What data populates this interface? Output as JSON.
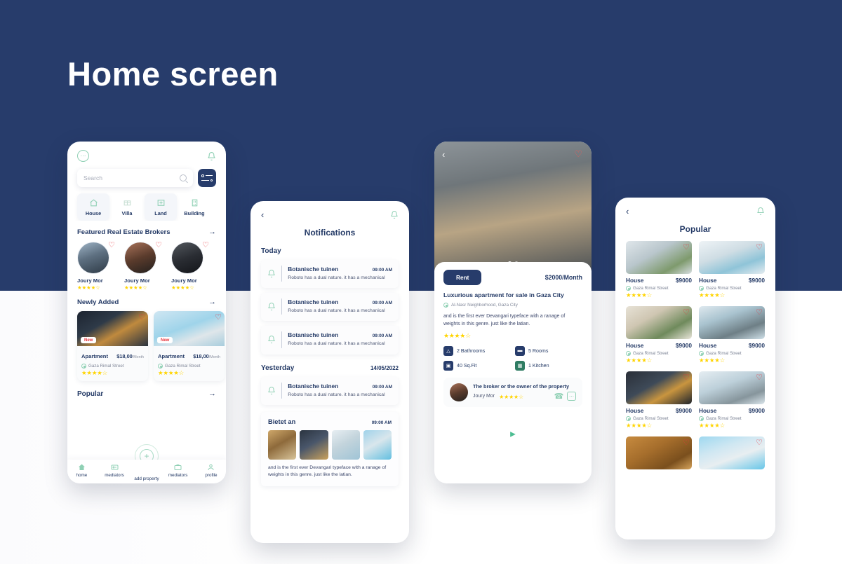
{
  "page": {
    "title": "Home screen",
    "bg_navy": "#273c6b",
    "accent_mint": "#8fd0b4",
    "accent_star": "#ffd400",
    "accent_heart": "#e8343c"
  },
  "screen1": {
    "icons": {
      "chat": "chat-icon",
      "bell": "bell-icon"
    },
    "search": {
      "placeholder": "Search",
      "value": ""
    },
    "filter_label": "filter-button",
    "categories": [
      {
        "label": "House",
        "icon": "house-icon",
        "active": true
      },
      {
        "label": "Villa",
        "icon": "villa-icon",
        "active": false
      },
      {
        "label": "Land",
        "icon": "land-icon",
        "active": true
      },
      {
        "label": "Building",
        "icon": "building-icon",
        "active": false
      }
    ],
    "brokers_section": {
      "title": "Featured Real Estate Brokers",
      "arrow": "→"
    },
    "brokers": [
      {
        "name": "Joury Mor",
        "stars": "★★★★☆"
      },
      {
        "name": "Joury Mor",
        "stars": "★★★★☆"
      },
      {
        "name": "Joury Mor",
        "stars": "★★★★☆"
      }
    ],
    "newly_section": {
      "title": "Newly Added",
      "arrow": "→"
    },
    "newly": [
      {
        "badge": "New",
        "type": "Apartment",
        "price": "$18,00",
        "per": "/Month",
        "location": "Gaza Rimal Street",
        "stars": "★★★★☆"
      },
      {
        "badge": "New",
        "type": "Apartment",
        "price": "$18,00",
        "per": "/Month",
        "location": "Gaza Rimal Street",
        "stars": "★★★★☆"
      }
    ],
    "popular_section": {
      "title": "Popular",
      "arrow": "→"
    },
    "nav": [
      {
        "label": "home",
        "icon": "home-icon"
      },
      {
        "label": "mediators",
        "icon": "mediators-icon"
      },
      {
        "label": "add property",
        "icon": "plus-icon"
      },
      {
        "label": "mediators",
        "icon": "briefcase-icon"
      },
      {
        "label": "profile",
        "icon": "profile-icon"
      }
    ]
  },
  "screen2": {
    "back": "‹",
    "bell": "bell-icon",
    "title": "Notifications",
    "today_label": "Today",
    "yesterday_label": "Yesterday",
    "yesterday_date": "14/05/2022",
    "items_today": [
      {
        "title": "Botanische tuinen",
        "time": "09:00 AM",
        "body": "Roboto has a dual nature.  it has a mechanical"
      },
      {
        "title": "Botanische tuinen",
        "time": "09:00 AM",
        "body": "Roboto has a dual nature.  it has a mechanical"
      },
      {
        "title": "Botanische tuinen",
        "time": "09:00 AM",
        "body": "Roboto has a dual nature.  it has a mechanical"
      }
    ],
    "items_yesterday": [
      {
        "title": "Botanische tuinen",
        "time": "09:00 AM",
        "body": "Roboto has a dual nature.  it has a mechanical"
      }
    ],
    "offer": {
      "title": "Bietet an",
      "time": "09:00 AM",
      "body": "and is the first ever Devangari  typeface with a ranage of weights in this genre. just like the latian."
    }
  },
  "screen3": {
    "back": "‹",
    "heart": "heart-icon",
    "rent_label": "Rent",
    "price": "$2000/Month",
    "title": "Luxurious apartment for sale in Gaza City",
    "location": "Al-Nasr Neighborhood, Gaza City",
    "description": "and is the first ever Devangari  typeface with a ranage of weights in this genre. just like the latian.",
    "stars": "★★★★☆",
    "features": [
      {
        "label": "2 Bathrooms",
        "icon": "bathtub-icon"
      },
      {
        "label": "5 Rooms",
        "icon": "bed-icon"
      },
      {
        "label": "40 Sq.Fit",
        "icon": "area-icon"
      },
      {
        "label": "1 Kitchen",
        "icon": "kitchen-icon"
      }
    ],
    "broker": {
      "heading": "The broker or the owner of the property",
      "name": "Joury Mor",
      "stars": "★★★★☆",
      "call_icon": "phone-icon",
      "chat_icon": "chat-icon"
    },
    "video_play": "play-icon"
  },
  "screen4": {
    "back": "‹",
    "bell": "bell-icon",
    "title": "Popular",
    "items": [
      {
        "type": "House",
        "price": "$9000",
        "location": "Gaza Rimal Street",
        "stars": "★★★★☆"
      },
      {
        "type": "House",
        "price": "$9000",
        "location": "Gaza Rimal Street",
        "stars": "★★★★☆"
      },
      {
        "type": "House",
        "price": "$9000",
        "location": "Gaza Rimal Street",
        "stars": "★★★★☆"
      },
      {
        "type": "House",
        "price": "$9000",
        "location": "Gaza Rimal Street",
        "stars": "★★★★☆"
      },
      {
        "type": "House",
        "price": "$9000",
        "location": "Gaza Rimal Street",
        "stars": "★★★★☆"
      },
      {
        "type": "House",
        "price": "$9000",
        "location": "Gaza Rimal Street",
        "stars": "★★★★☆"
      },
      {
        "type": "",
        "price": "",
        "location": "",
        "stars": ""
      },
      {
        "type": "",
        "price": "",
        "location": "",
        "stars": ""
      }
    ]
  }
}
